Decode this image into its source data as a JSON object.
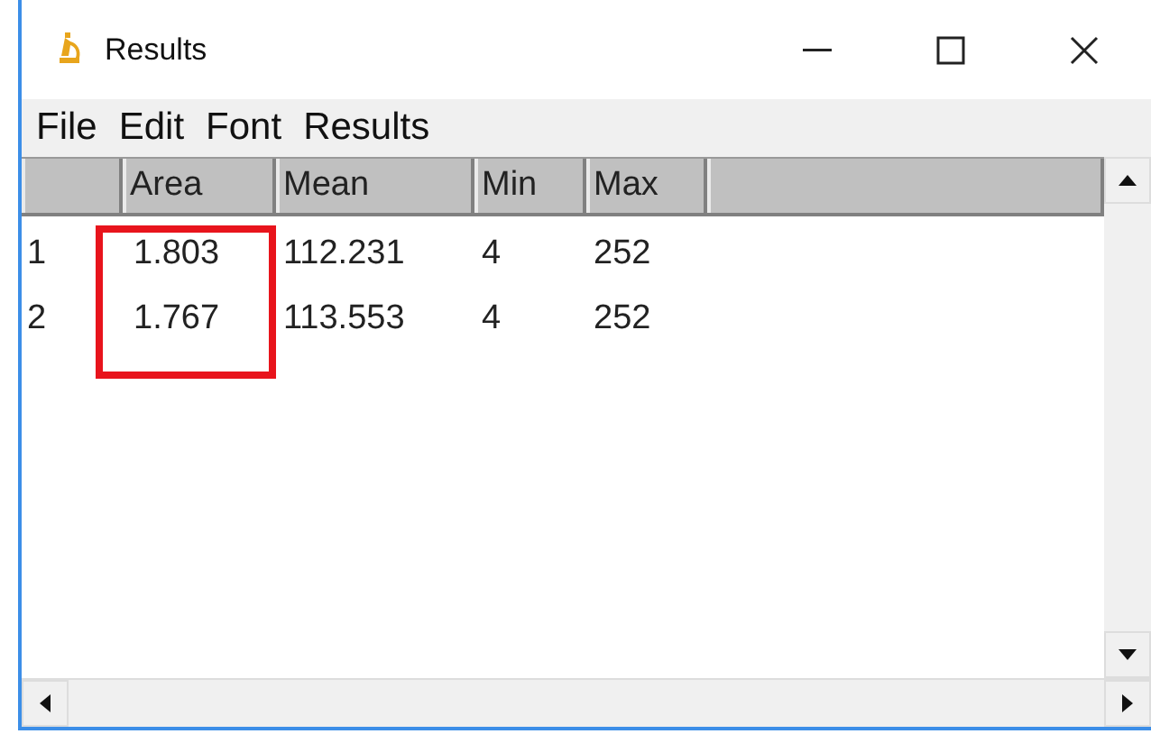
{
  "window": {
    "title": "Results"
  },
  "menu": [
    "File",
    "Edit",
    "Font",
    "Results"
  ],
  "table": {
    "columns": [
      {
        "label": "Area",
        "highlighted": true
      },
      {
        "label": "Mean",
        "highlighted": false
      },
      {
        "label": "Min",
        "highlighted": false
      },
      {
        "label": "Max",
        "highlighted": false
      }
    ],
    "rows": [
      {
        "number": "1",
        "cells": [
          "1.803",
          "112.231",
          "4",
          "252"
        ]
      },
      {
        "number": "2",
        "cells": [
          "1.767",
          "113.553",
          "4",
          "252"
        ]
      }
    ]
  }
}
